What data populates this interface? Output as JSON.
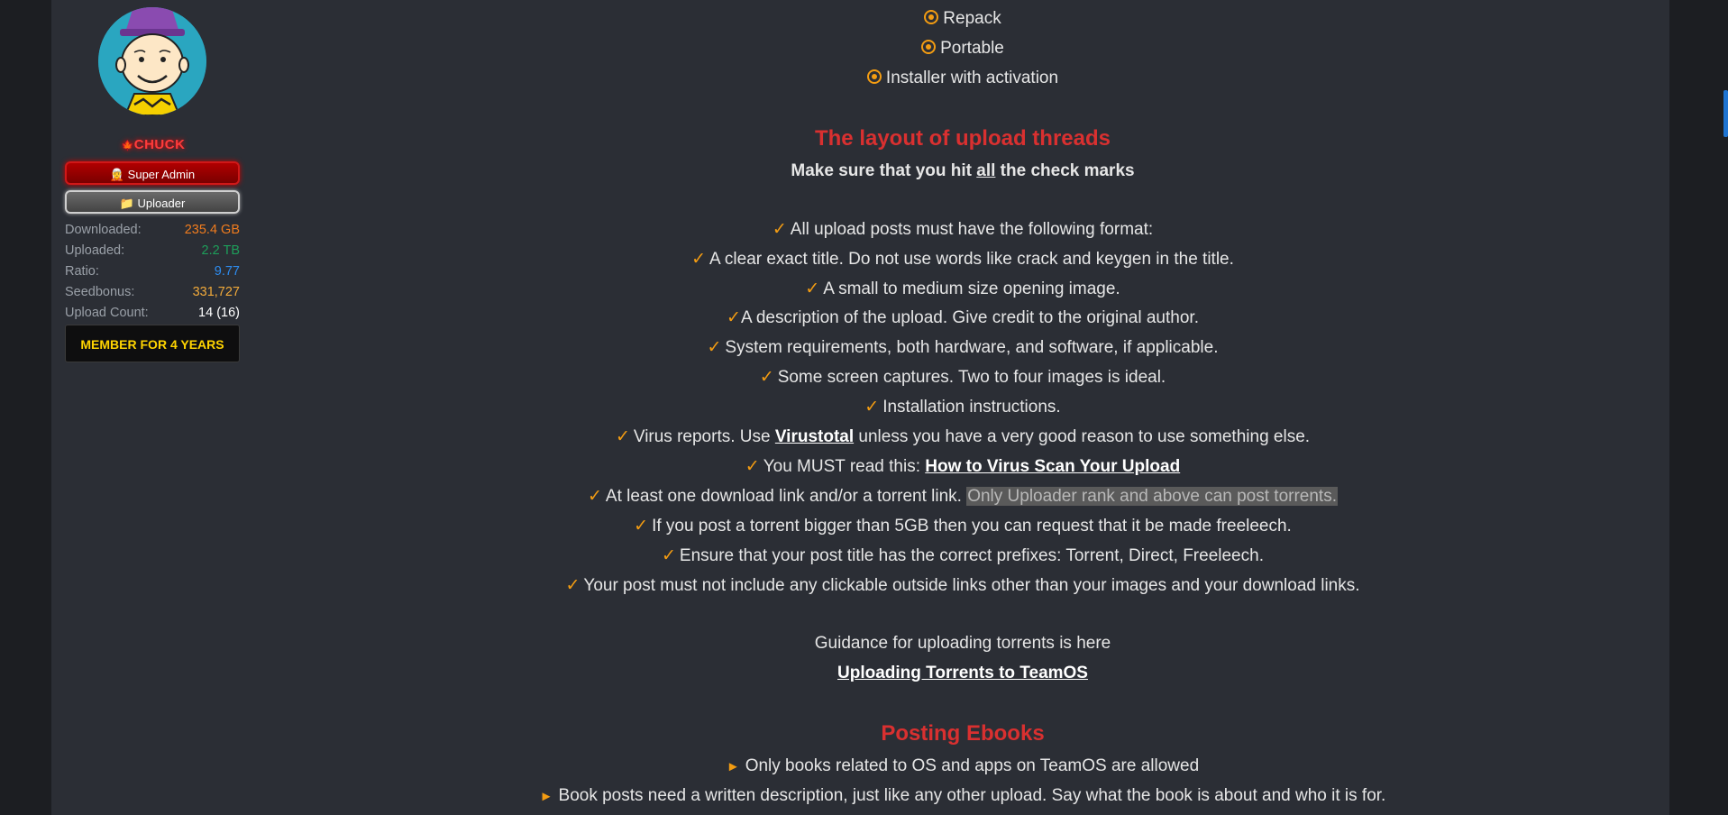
{
  "sidebar": {
    "username": "CHUCK",
    "badges": {
      "super_admin": "🧝 Super Admin",
      "uploader": "📁 Uploader"
    },
    "stats": [
      {
        "label": "Downloaded:",
        "value": "235.4 GB",
        "color": "#f07c1e"
      },
      {
        "label": "Uploaded:",
        "value": "2.2 TB",
        "color": "#1e9e5a"
      },
      {
        "label": "Ratio:",
        "value": "9.77",
        "color": "#2d8cf0"
      },
      {
        "label": "Seedbonus:",
        "value": "331,727",
        "color": "#f0a93a"
      },
      {
        "label": "Upload Count:",
        "value": "14 (16)",
        "color": "#ffffff"
      }
    ],
    "member_badge": "MEMBER FOR 4 YEARS"
  },
  "content": {
    "options": [
      "Repack",
      "Portable",
      "Installer with activation"
    ],
    "layout_heading": "The layout of upload threads",
    "check_marks_intro": {
      "before": "Make sure that you hit ",
      "emph": "all",
      "after": " the check marks"
    },
    "checklist": {
      "c1": "All upload posts must have the following format:",
      "c2": "A clear exact title. Do not use words like crack and keygen in the title.",
      "c3": "A small to medium size opening image.",
      "c4": "A description of the upload. Give credit to the original author.",
      "c5": "System requirements, both hardware, and software, if applicable.",
      "c6": "Some screen captures. Two to four images is ideal.",
      "c7": "Installation instructions.",
      "c8_before": "Virus reports. Use ",
      "c8_link": "Virustotal",
      "c8_after": " unless you have a very good reason to use something else.",
      "c9_before": "You MUST read this: ",
      "c9_link": "How to Virus Scan Your Upload",
      "c10_before": "At least one download link and/or a torrent link. ",
      "c10_highlight": "Only Uploader rank and above can post torrents.",
      "c11": "If you post a torrent bigger than 5GB then you can request that it be made freeleech.",
      "c12": "Ensure that your post title has the correct prefixes: Torrent, Direct, Freeleech.",
      "c13": "Your post must not include any clickable outside links other than your images and your download links."
    },
    "guidance_text": "Guidance for uploading torrents is here",
    "guidance_link": "Uploading Torrents to TeamOS",
    "ebooks_heading": "Posting Ebooks",
    "ebooks": [
      "Only books related to OS and apps on TeamOS are allowed",
      "Book posts need a written description, just like any other upload. Say what the book is about and who it is for."
    ],
    "check_glyph": "✓",
    "arrow_glyph": "►"
  }
}
